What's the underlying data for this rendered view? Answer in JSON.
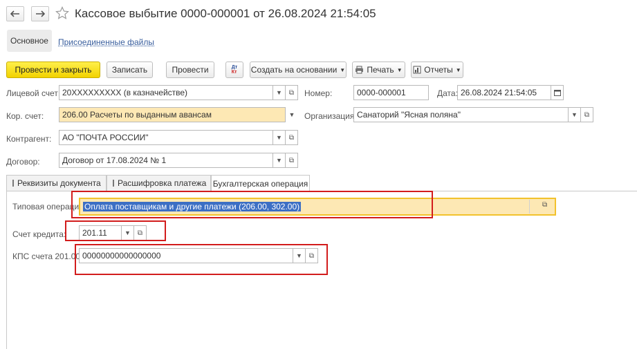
{
  "header": {
    "back_icon": "arrow-left-icon",
    "forward_icon": "arrow-right-icon",
    "favorite_icon": "star-icon",
    "title": "Кассовое выбытие 0000-000001 от 26.08.2024 21:54:05"
  },
  "nav": {
    "main_tab": "Основное",
    "attached_files": "Присоединенные файлы"
  },
  "toolbar": {
    "post_and_close": "Провести и закрыть",
    "save": "Записать",
    "post": "Провести",
    "create_based_on": "Создать на основании",
    "print": "Печать",
    "reports": "Отчеты",
    "dtkt_icon": "debit-credit-icon",
    "print_icon": "printer-icon",
    "reports_icon": "report-icon"
  },
  "form": {
    "account_label": "Лицевой счет:",
    "account_value": "20XXXXXXXXX (в казначействе)",
    "number_label": "Номер:",
    "number_value": "0000-000001",
    "date_label": "Дата:",
    "date_value": "26.08.2024 21:54:05",
    "corr_label": "Кор. счет:",
    "corr_value": "206.00 Расчеты по выданным авансам",
    "org_label": "Организация:",
    "org_value": "Санаторий \"Ясная поляна\"",
    "counterparty_label": "Контрагент:",
    "counterparty_value": "АО \"ПОЧТА РОССИИ\"",
    "contract_label": "Договор:",
    "contract_value": "Договор от 17.08.2024 № 1"
  },
  "tabs": [
    {
      "label": "Реквизиты документа"
    },
    {
      "label": "Расшифровка платежа"
    },
    {
      "label": "Бухгалтерская операция"
    }
  ],
  "operation": {
    "typical_label": "Типовая операция:",
    "typical_value": "Оплата поставщикам и другие платежи (206.00, 302.00)",
    "credit_label": "Счет кредита:",
    "credit_value": "201.11",
    "kps_label": "КПС счета 201.00:",
    "kps_value": "00000000000000000"
  }
}
